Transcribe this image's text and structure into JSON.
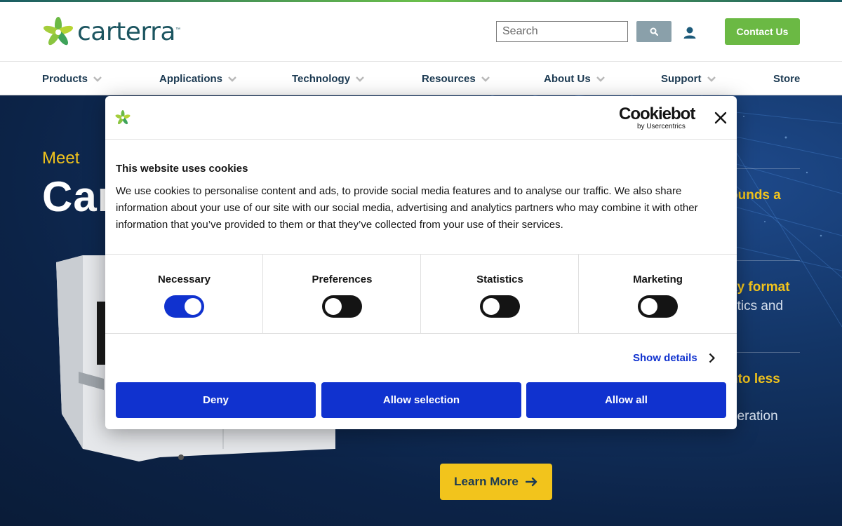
{
  "brand": {
    "name": "carterra",
    "tm": "™"
  },
  "header": {
    "search_placeholder": "Search",
    "contact_label": "Contact Us"
  },
  "nav": {
    "items": [
      {
        "label": "Products",
        "has_menu": true
      },
      {
        "label": "Applications",
        "has_menu": true
      },
      {
        "label": "Technology",
        "has_menu": true
      },
      {
        "label": "Resources",
        "has_menu": true
      },
      {
        "label": "About Us",
        "has_menu": true
      },
      {
        "label": "Support",
        "has_menu": true
      },
      {
        "label": "Store",
        "has_menu": false
      }
    ]
  },
  "hero": {
    "eyebrow": "Meet",
    "title_visible": "Car",
    "features": [
      {
        "highlight": "ounds a",
        "sub": ""
      },
      {
        "highlight": "ay format",
        "sub": "etics and"
      },
      {
        "highlight": "nto less",
        "sub": "peration"
      }
    ],
    "cta_label": "Learn More"
  },
  "cookie_dialog": {
    "brand_main": "Cookiebot",
    "brand_sub": "by Usercentrics",
    "title": "This website uses cookies",
    "body": "We use cookies to personalise content and ads, to provide social media features and to analyse our traffic. We also share information about your use of our site with our social media, advertising and analytics partners who may combine it with other information that you’ve provided to them or that they’ve collected from your use of their services.",
    "categories": [
      {
        "label": "Necessary",
        "enabled": true
      },
      {
        "label": "Preferences",
        "enabled": false
      },
      {
        "label": "Statistics",
        "enabled": false
      },
      {
        "label": "Marketing",
        "enabled": false
      }
    ],
    "show_details_label": "Show details",
    "buttons": {
      "deny": "Deny",
      "allow_selection": "Allow selection",
      "allow_all": "Allow all"
    }
  },
  "colors": {
    "brand_teal": "#1c5560",
    "brand_green": "#6bb944",
    "nav_text": "#1c3a52",
    "hero_accent": "#f2c41c",
    "cookie_blue": "#1032cf"
  },
  "icons": [
    "carterra-star-logo-icon",
    "search-icon",
    "user-icon",
    "chevron-down-icon",
    "arrow-right-icon",
    "close-icon",
    "chevron-right-icon"
  ]
}
